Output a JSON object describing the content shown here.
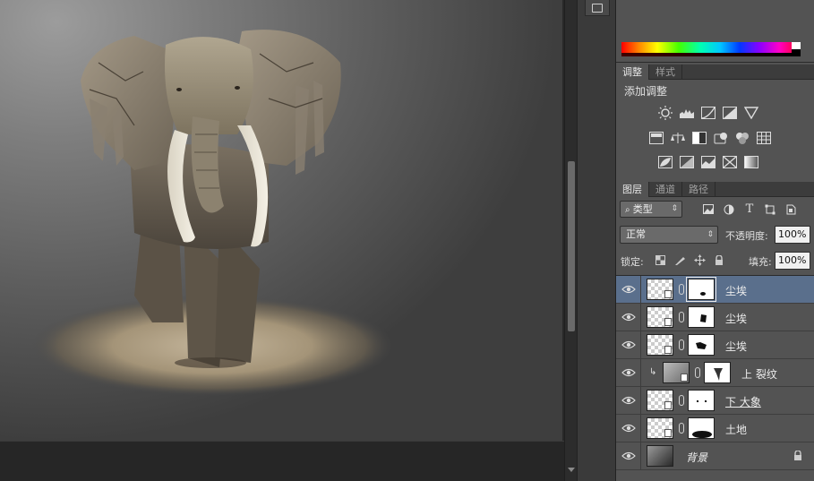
{
  "colors": {
    "panel_bg": "#535353",
    "selected_row": "#5a6f8c",
    "dark_bg": "#282828"
  },
  "adjustments_panel": {
    "tabs": [
      {
        "label": "调整",
        "active": true
      },
      {
        "label": "样式",
        "active": false
      }
    ],
    "title": "添加调整",
    "icons_row1": [
      "brightness-contrast-icon",
      "levels-icon",
      "curves-icon",
      "exposure-icon",
      "vibrance-icon"
    ],
    "icons_row2": [
      "hue-saturation-icon",
      "color-balance-icon",
      "black-white-icon",
      "photo-filter-icon",
      "channel-mixer-icon",
      "color-lookup-icon"
    ],
    "icons_row3": [
      "invert-icon",
      "posterize-icon",
      "threshold-icon",
      "selective-color-icon",
      "gradient-map-icon"
    ]
  },
  "layers_panel": {
    "tabs": [
      {
        "label": "图层",
        "active": true
      },
      {
        "label": "通道",
        "active": false
      },
      {
        "label": "路径",
        "active": false
      }
    ],
    "kind_filter": "类型",
    "filter_icons": [
      "pixel-filter-icon",
      "adjustment-filter-icon",
      "type-filter-icon",
      "shape-filter-icon",
      "smart-object-filter-icon"
    ],
    "blend_mode": "正常",
    "opacity_label": "不透明度:",
    "opacity_value": "100%",
    "lock_label": "锁定:",
    "fill_label": "填充:",
    "fill_value": "100%",
    "layers": [
      {
        "name": "尘埃",
        "selected": true
      },
      {
        "name": "尘埃",
        "selected": false
      },
      {
        "name": "尘埃",
        "selected": false
      },
      {
        "name": "上 裂纹",
        "selected": false,
        "clipped": true
      },
      {
        "name": "下 大象",
        "selected": false
      },
      {
        "name": "土地",
        "selected": false
      },
      {
        "name": "背景",
        "selected": false,
        "locked": true
      }
    ]
  }
}
